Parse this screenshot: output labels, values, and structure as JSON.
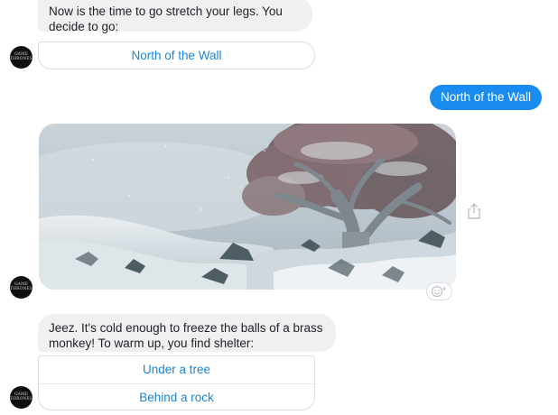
{
  "conversation": {
    "bot_avatar_text": "Game of Thrones",
    "messages": [
      {
        "type": "bot-text",
        "text": "Now is the time to go stretch your legs. You decide to go:",
        "options": [
          "North of the Wall"
        ]
      },
      {
        "type": "user-text",
        "text": "North of the Wall"
      },
      {
        "type": "bot-image",
        "image_subject": "snowy landscape with large tree",
        "actions": [
          "share-icon",
          "add-reaction-icon"
        ]
      },
      {
        "type": "bot-text",
        "text": "Jeez. It's cold enough to freeze the balls of a brass monkey! To warm up, you find shelter:",
        "options": [
          "Under a tree",
          "Behind a rock"
        ]
      }
    ]
  },
  "colors": {
    "accent_blue": "#1a86d9",
    "sent_bubble": "#1a8cf0",
    "received_bubble": "#f1f0f0"
  }
}
